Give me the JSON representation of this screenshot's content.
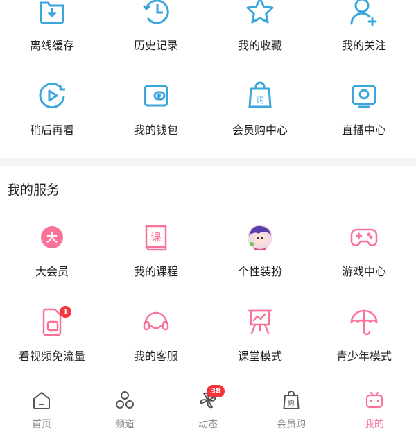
{
  "top_grid": [
    {
      "label": "离线缓存",
      "icon": "download-folder-icon"
    },
    {
      "label": "历史记录",
      "icon": "history-clock-icon"
    },
    {
      "label": "我的收藏",
      "icon": "star-icon"
    },
    {
      "label": "我的关注",
      "icon": "add-person-icon"
    },
    {
      "label": "稍后再看",
      "icon": "watch-later-icon"
    },
    {
      "label": "我的钱包",
      "icon": "wallet-icon"
    },
    {
      "label": "会员购中心",
      "icon": "shopping-bag-icon"
    },
    {
      "label": "直播中心",
      "icon": "live-tv-icon"
    }
  ],
  "services": {
    "title": "我的服务",
    "items": [
      {
        "label": "大会员",
        "icon": "vip-icon",
        "icon_text": "大"
      },
      {
        "label": "我的课程",
        "icon": "course-book-icon",
        "icon_text": "课"
      },
      {
        "label": "个性装扮",
        "icon": "avatar-costume-icon"
      },
      {
        "label": "游戏中心",
        "icon": "gamepad-icon"
      },
      {
        "label": "看视频免流量",
        "icon": "sim-card-icon",
        "badge": "1"
      },
      {
        "label": "我的客服",
        "icon": "headset-icon"
      },
      {
        "label": "课堂模式",
        "icon": "presentation-board-icon"
      },
      {
        "label": "青少年模式",
        "icon": "umbrella-icon"
      }
    ]
  },
  "tabbar": {
    "tabs": [
      {
        "label": "首页",
        "icon": "home-icon"
      },
      {
        "label": "频道",
        "icon": "channels-icon"
      },
      {
        "label": "动态",
        "icon": "pinwheel-icon",
        "badge": "38"
      },
      {
        "label": "会员购",
        "icon": "shopping-bag-icon"
      },
      {
        "label": "我的",
        "icon": "tv-mascot-icon",
        "active": true
      }
    ]
  },
  "colors": {
    "blue": "#3aa6dd",
    "pink": "#fb7299",
    "badge": "#f5343b"
  }
}
